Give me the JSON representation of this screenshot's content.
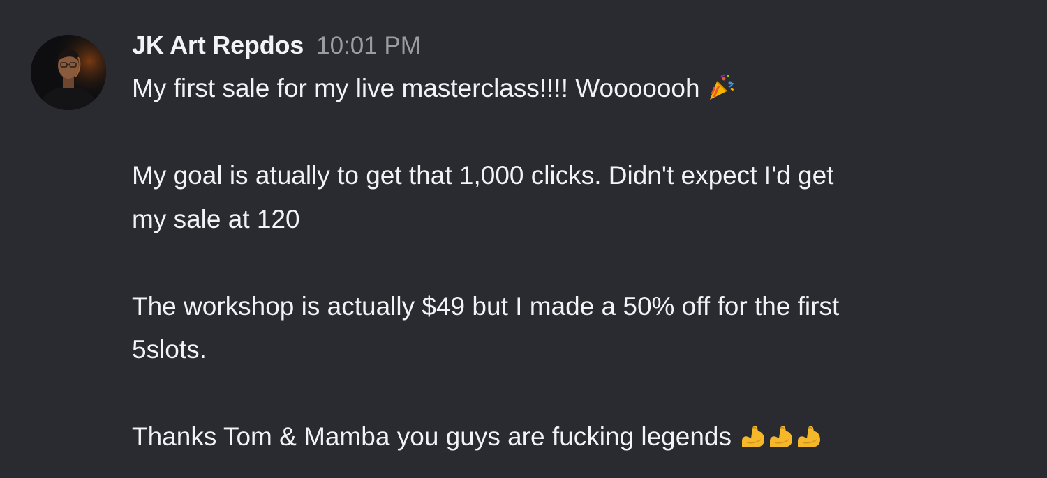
{
  "message": {
    "author": "JK Art Repdos",
    "timestamp": "10:01 PM",
    "lines": {
      "l1": "My first sale for my live masterclass!!!! Wooooooh",
      "l3": "My goal is atually to get that 1,000 clicks. Didn't expect I'd get",
      "l4": "my sale at 120",
      "l6": "The workshop is actually $49 but I made a 50% off for the first",
      "l7": "5slots.",
      "l9": "Thanks Tom & Mamba you guys are fucking legends"
    },
    "emojis": {
      "party": "party-popper-icon",
      "muscle": "flexed-biceps-icon"
    }
  },
  "colors": {
    "background": "#2a2b31",
    "text": "#f2f3f5",
    "timestamp": "#9a9ca3"
  }
}
